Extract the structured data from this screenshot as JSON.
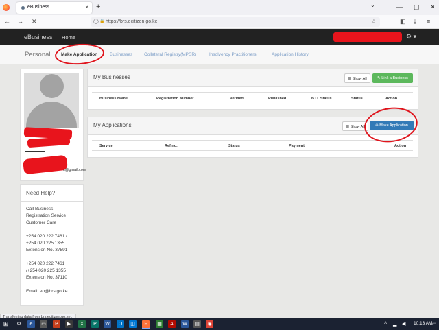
{
  "browser": {
    "tab_title": "eBusiness",
    "tab_close": "×",
    "new_tab": "+",
    "url": "https://brs.ecitizen.go.ke",
    "back_icon": "←",
    "forward_icon": "→",
    "stop_icon": "✕",
    "shield_icon": "◯",
    "lock_icon": "🔒",
    "bookmark_star": "☆",
    "pocket_icon": "◧",
    "extension_icon": "⤓",
    "menu_icon": "≡",
    "minimize": "—",
    "maximize": "▢",
    "close": "✕"
  },
  "header": {
    "brand": "eBusiness",
    "home": "Home",
    "settings_icon": "⚙ ▾",
    "accent_red": "#e8141c"
  },
  "subnav": {
    "personal": "Personal",
    "items": [
      "Make Application",
      "Businesses",
      "Collateral Registry(MPSR)",
      "Insolvency Practitioners",
      "Application History"
    ]
  },
  "profile": {
    "email": "s@gmail.com"
  },
  "help": {
    "title": "Need Help?",
    "lines": [
      "Call Business",
      "Registration Service",
      "Customer Care",
      "",
      "+254 020 222 7461 /",
      "+254 020 225 1355",
      "Extension No. 37591",
      "",
      "+254 020 222 7461",
      "/+254 020 225 1355",
      "Extension No. 37110",
      "",
      "Email: eo@brs.go.ke"
    ]
  },
  "businesses": {
    "title": "My Businesses",
    "show_all": "Show All",
    "link_button": "Link a Business",
    "columns": [
      "Business Name",
      "Registration Number",
      "Verified",
      "Published",
      "B.O. Status",
      "Status",
      "Action"
    ]
  },
  "applications": {
    "title": "My Applications",
    "show_all": "Show All",
    "make_button": "Make Application",
    "columns": [
      "Service",
      "Ref no.",
      "Status",
      "Payment",
      "Action"
    ]
  },
  "status_bar": "Transferring data from brs.ecitizen.go.ke...",
  "taskbar": {
    "start_icon": "⊞",
    "search_icon": "⚲",
    "time": "10:13 AM",
    "apps": [
      "e",
      "P",
      "X",
      "P",
      "W",
      "O",
      "F",
      "▦",
      "A",
      "W",
      "▤",
      "◉"
    ]
  }
}
